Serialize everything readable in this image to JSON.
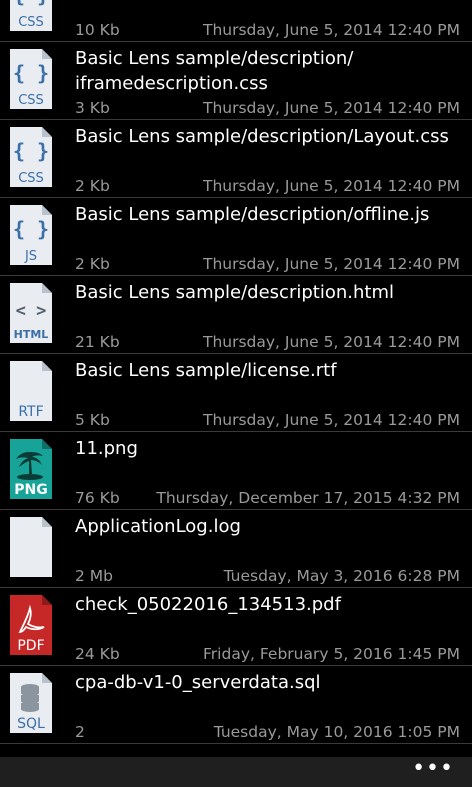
{
  "files": [
    {
      "icon": "css-file-icon",
      "type_label": "CSS",
      "name": "",
      "size": "10 Kb",
      "date": "Thursday, June 5, 2014 12:40 PM"
    },
    {
      "icon": "css-file-icon",
      "type_label": "CSS",
      "name": "Basic Lens sample/description/\niframedescription.css",
      "size": "3 Kb",
      "date": "Thursday, June 5, 2014 12:40 PM"
    },
    {
      "icon": "css-file-icon",
      "type_label": "CSS",
      "name": "Basic Lens sample/description/Layout.css",
      "size": "2 Kb",
      "date": "Thursday, June 5, 2014 12:40 PM"
    },
    {
      "icon": "js-file-icon",
      "type_label": "JS",
      "name": "Basic Lens sample/description/offline.js",
      "size": "2 Kb",
      "date": "Thursday, June 5, 2014 12:40 PM"
    },
    {
      "icon": "html-file-icon",
      "type_label": "HTML",
      "name": "Basic Lens sample/description.html",
      "size": "21 Kb",
      "date": "Thursday, June 5, 2014 12:40 PM"
    },
    {
      "icon": "rtf-file-icon",
      "type_label": "RTF",
      "name": "Basic Lens sample/license.rtf",
      "size": "5 Kb",
      "date": "Thursday, June 5, 2014 12:40 PM"
    },
    {
      "icon": "png-file-icon",
      "type_label": "PNG",
      "name": "11.png",
      "size": "76 Kb",
      "date": "Thursday, December 17, 2015 4:32 PM"
    },
    {
      "icon": "generic-file-icon",
      "type_label": "",
      "name": "ApplicationLog.log",
      "size": "2 Mb",
      "date": "Tuesday, May 3, 2016 6:28 PM"
    },
    {
      "icon": "pdf-file-icon",
      "type_label": "PDF",
      "name": "check_05022016_134513.pdf",
      "size": "24 Kb",
      "date": "Friday, February 5, 2016 1:45 PM"
    },
    {
      "icon": "sql-file-icon",
      "type_label": "SQL",
      "name": "cpa-db-v1-0_serverdata.sql",
      "size": "2",
      "date": "Tuesday, May 10, 2016 1:05 PM"
    }
  ],
  "appbar": {
    "more_label": "•••"
  },
  "colors": {
    "background": "#000000",
    "secondary_text": "#9a9a9a",
    "appbar": "#1f1f1f",
    "png_accent": "#17a398",
    "pdf_accent": "#c62828",
    "doc_glyph": "#3b6fa8"
  }
}
